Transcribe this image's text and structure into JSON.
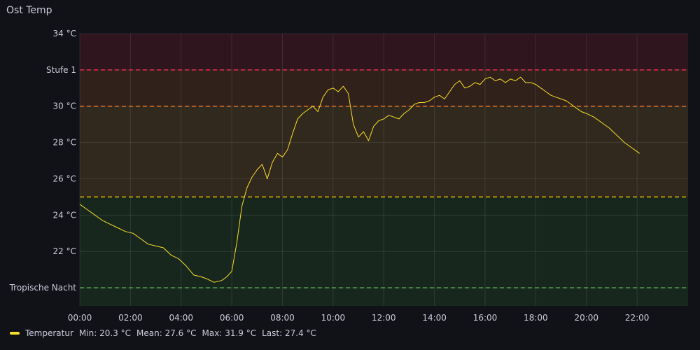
{
  "panel": {
    "title": "Ost Temp"
  },
  "legend": {
    "series_label": "Temperatur",
    "min_label": "Min:",
    "min_value": "20.3 °C",
    "mean_label": "Mean:",
    "mean_value": "27.6 °C",
    "max_label": "Max:",
    "max_value": "31.9 °C",
    "last_label": "Last:",
    "last_value": "27.4 °C"
  },
  "colors": {
    "background": "#111217",
    "line": "#fade2a",
    "grid": "#2b2d35",
    "band_green": "#18271e",
    "band_yellow": "#31291d",
    "band_orange": "#31211b",
    "band_red": "#2f151d",
    "threshold_green": "#56a64b",
    "threshold_yellow": "#e0b400",
    "threshold_orange": "#e8761e",
    "threshold_red": "#e02f44"
  },
  "chart_data": {
    "type": "line",
    "title": "Ost Temp",
    "xlabel": "",
    "ylabel": "",
    "xlim": [
      0,
      24
    ],
    "ylim": [
      19,
      34
    ],
    "grid": true,
    "legend_position": "bottom-left",
    "x_ticks": [
      {
        "value": 0,
        "label": "00:00"
      },
      {
        "value": 2,
        "label": "02:00"
      },
      {
        "value": 4,
        "label": "04:00"
      },
      {
        "value": 6,
        "label": "06:00"
      },
      {
        "value": 8,
        "label": "08:00"
      },
      {
        "value": 10,
        "label": "10:00"
      },
      {
        "value": 12,
        "label": "12:00"
      },
      {
        "value": 14,
        "label": "14:00"
      },
      {
        "value": 16,
        "label": "16:00"
      },
      {
        "value": 18,
        "label": "18:00"
      },
      {
        "value": 20,
        "label": "20:00"
      },
      {
        "value": 22,
        "label": "22:00"
      }
    ],
    "y_ticks": [
      {
        "value": 20,
        "label": "Tropische Nacht"
      },
      {
        "value": 22,
        "label": "22 °C"
      },
      {
        "value": 24,
        "label": "24 °C"
      },
      {
        "value": 26,
        "label": "26 °C"
      },
      {
        "value": 28,
        "label": "28 °C"
      },
      {
        "value": 30,
        "label": "30 °C"
      },
      {
        "value": 32,
        "label": "Stufe 1"
      },
      {
        "value": 34,
        "label": "34 °C"
      }
    ],
    "thresholds": [
      {
        "from": 19,
        "to": 25,
        "band": "green",
        "line_value": 20,
        "line_color": "green"
      },
      {
        "from": 25,
        "to": 30,
        "band": "yellow",
        "line_value": 25,
        "line_color": "yellow"
      },
      {
        "from": 30,
        "to": 32,
        "band": "orange",
        "line_value": 30,
        "line_color": "orange"
      },
      {
        "from": 32,
        "to": 34,
        "band": "red",
        "line_value": 32,
        "line_color": "red"
      }
    ],
    "series": [
      {
        "name": "Temperatur",
        "color": "#fade2a",
        "x": [
          0.0,
          0.3,
          0.6,
          0.9,
          1.2,
          1.5,
          1.8,
          2.1,
          2.4,
          2.7,
          3.0,
          3.3,
          3.6,
          3.9,
          4.2,
          4.5,
          4.8,
          5.0,
          5.3,
          5.6,
          5.8,
          6.0,
          6.2,
          6.4,
          6.6,
          6.8,
          7.0,
          7.2,
          7.4,
          7.6,
          7.8,
          8.0,
          8.2,
          8.4,
          8.6,
          8.8,
          9.0,
          9.2,
          9.4,
          9.6,
          9.8,
          10.0,
          10.2,
          10.4,
          10.6,
          10.8,
          11.0,
          11.2,
          11.4,
          11.6,
          11.8,
          12.0,
          12.2,
          12.4,
          12.6,
          12.8,
          13.0,
          13.2,
          13.4,
          13.6,
          13.8,
          14.0,
          14.2,
          14.4,
          14.6,
          14.8,
          15.0,
          15.2,
          15.4,
          15.6,
          15.8,
          16.0,
          16.2,
          16.4,
          16.6,
          16.8,
          17.0,
          17.2,
          17.4,
          17.6,
          17.8,
          18.0,
          18.2,
          18.4,
          18.6,
          18.8,
          19.0,
          19.2,
          19.4,
          19.6,
          19.8,
          20.0,
          20.3,
          20.6,
          20.9,
          21.2,
          21.5,
          21.8,
          22.1
        ],
        "values": [
          24.6,
          24.3,
          24.0,
          23.7,
          23.5,
          23.3,
          23.1,
          23.0,
          22.7,
          22.4,
          22.3,
          22.2,
          21.8,
          21.6,
          21.2,
          20.7,
          20.6,
          20.5,
          20.3,
          20.4,
          20.6,
          20.9,
          22.5,
          24.5,
          25.5,
          26.1,
          26.5,
          26.8,
          26.0,
          26.9,
          27.4,
          27.2,
          27.6,
          28.5,
          29.3,
          29.6,
          29.8,
          30.0,
          29.7,
          30.5,
          30.9,
          31.0,
          30.8,
          31.1,
          30.7,
          29.0,
          28.3,
          28.6,
          28.1,
          28.9,
          29.2,
          29.3,
          29.5,
          29.4,
          29.3,
          29.6,
          29.8,
          30.1,
          30.2,
          30.2,
          30.3,
          30.5,
          30.6,
          30.4,
          30.8,
          31.2,
          31.4,
          31.0,
          31.1,
          31.3,
          31.2,
          31.5,
          31.6,
          31.4,
          31.5,
          31.3,
          31.5,
          31.4,
          31.6,
          31.3,
          31.3,
          31.2,
          31.0,
          30.8,
          30.6,
          30.5,
          30.4,
          30.3,
          30.1,
          29.9,
          29.7,
          29.6,
          29.4,
          29.1,
          28.8,
          28.4,
          28.0,
          27.7,
          27.4
        ]
      }
    ]
  }
}
